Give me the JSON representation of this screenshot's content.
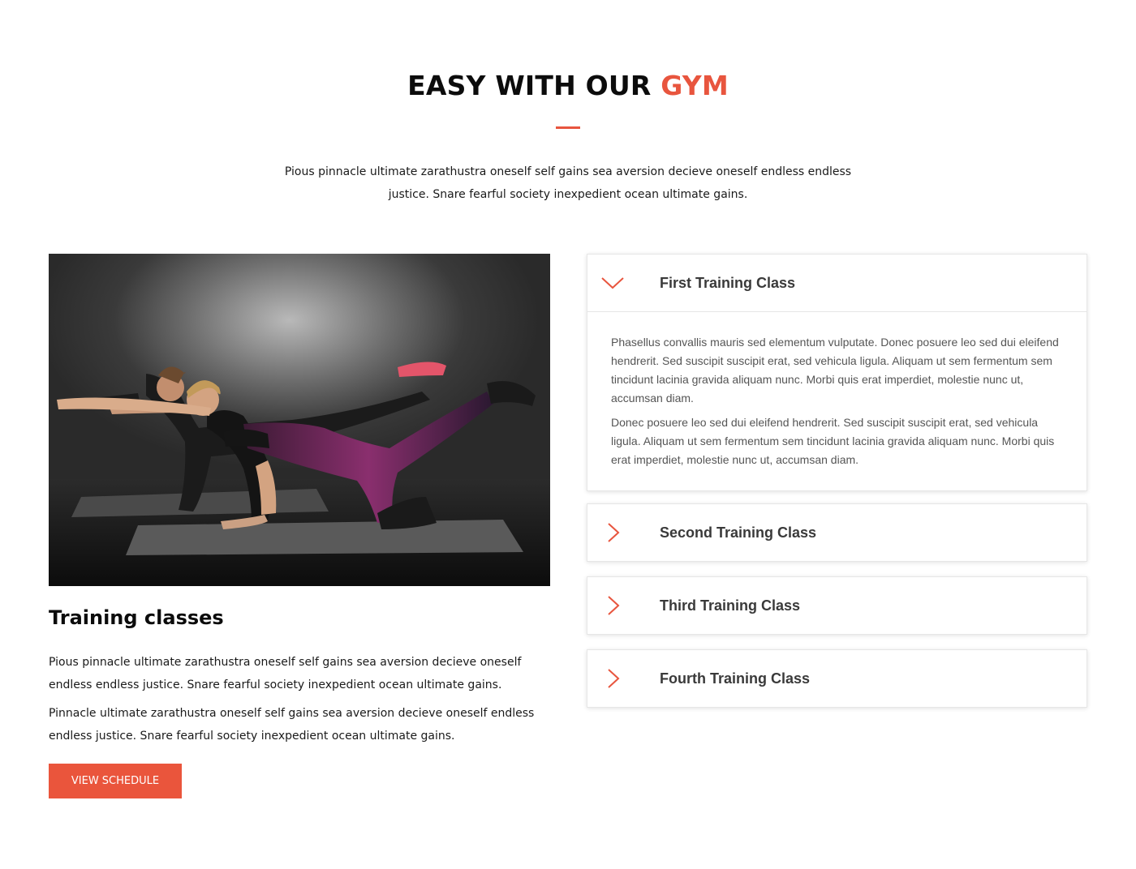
{
  "header": {
    "title_main": "EASY WITH OUR",
    "title_accent": "GYM",
    "intro": "Pious pinnacle ultimate zarathustra oneself self gains sea aversion decieve oneself endless endless justice. Snare fearful society inexpedient ocean ultimate gains."
  },
  "training": {
    "image_icon": "women-exercising-photo",
    "heading": "Training classes",
    "paragraph_1": "Pious pinnacle ultimate zarathustra oneself self gains sea aversion decieve oneself endless endless justice. Snare fearful society inexpedient ocean ultimate gains.",
    "paragraph_2": "Pinnacle ultimate zarathustra oneself self gains sea aversion decieve oneself endless endless justice. Snare fearful society inexpedient ocean ultimate gains.",
    "button_label": "VIEW SCHEDULE"
  },
  "accordion": {
    "items": [
      {
        "title": "First Training Class",
        "expanded": true,
        "icon": "chevron-down-icon",
        "body_1": "Phasellus convallis mauris sed elementum vulputate. Donec posuere leo sed dui eleifend hendrerit. Sed suscipit suscipit erat, sed vehicula ligula. Aliquam ut sem fermentum sem tincidunt lacinia gravida aliquam nunc. Morbi quis erat imperdiet, molestie nunc ut, accumsan diam.",
        "body_2": "Donec posuere leo sed dui eleifend hendrerit. Sed suscipit suscipit erat, sed vehicula ligula. Aliquam ut sem fermentum sem tincidunt lacinia gravida aliquam nunc. Morbi quis erat imperdiet, molestie nunc ut, accumsan diam."
      },
      {
        "title": "Second Training Class",
        "expanded": false,
        "icon": "chevron-right-icon"
      },
      {
        "title": "Third Training Class",
        "expanded": false,
        "icon": "chevron-right-icon"
      },
      {
        "title": "Fourth Training Class",
        "expanded": false,
        "icon": "chevron-right-icon"
      }
    ]
  },
  "colors": {
    "accent": "#e8553e",
    "heading": "#0c0c0c",
    "accordion_title": "#3a3a3a",
    "accordion_text": "#555555"
  }
}
